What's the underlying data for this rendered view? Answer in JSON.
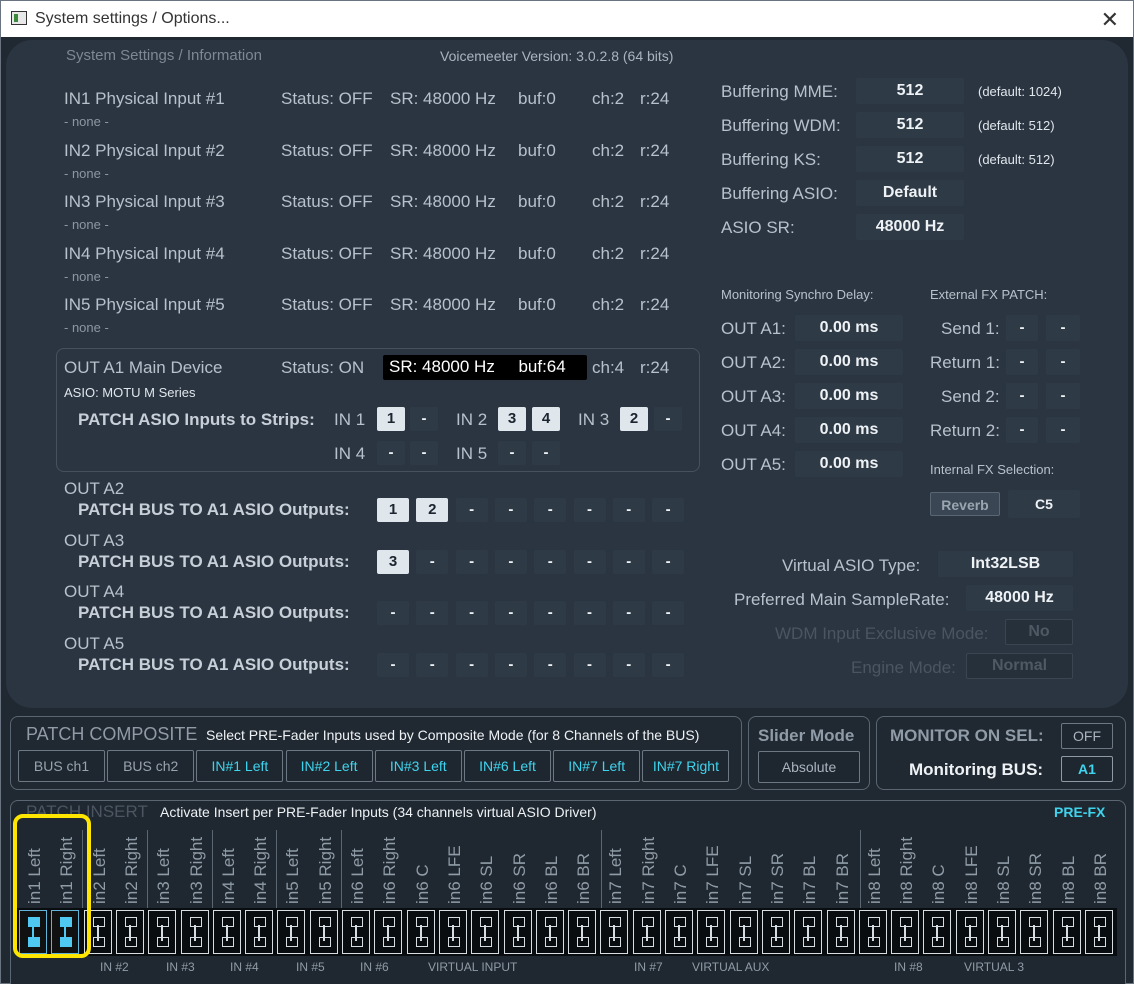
{
  "window": {
    "title": "System settings / Options..."
  },
  "header": {
    "section": "System Settings / Information",
    "version": "Voicemeeter Version: 3.0.2.8 (64 bits)"
  },
  "inputs": [
    {
      "name": "IN1 Physical Input #1",
      "device": "- none -",
      "status": "Status: OFF",
      "sr": "SR: 48000 Hz",
      "buf": "buf:0",
      "ch": "ch:2",
      "r": "r:24"
    },
    {
      "name": "IN2 Physical Input #2",
      "device": "- none -",
      "status": "Status: OFF",
      "sr": "SR: 48000 Hz",
      "buf": "buf:0",
      "ch": "ch:2",
      "r": "r:24"
    },
    {
      "name": "IN3 Physical Input #3",
      "device": "- none -",
      "status": "Status: OFF",
      "sr": "SR: 48000 Hz",
      "buf": "buf:0",
      "ch": "ch:2",
      "r": "r:24"
    },
    {
      "name": "IN4 Physical Input #4",
      "device": "- none -",
      "status": "Status: OFF",
      "sr": "SR: 48000 Hz",
      "buf": "buf:0",
      "ch": "ch:2",
      "r": "r:24"
    },
    {
      "name": "IN5 Physical Input #5",
      "device": "- none -",
      "status": "Status: OFF",
      "sr": "SR: 48000 Hz",
      "buf": "buf:0",
      "ch": "ch:2",
      "r": "r:24"
    }
  ],
  "a1": {
    "name": "OUT A1 Main Device",
    "device": "ASIO: MOTU M Series",
    "status": "Status: ON",
    "sr_buf": "SR: 48000 Hz     buf:64",
    "ch": "ch:4",
    "r": "r:24",
    "patch_label": "PATCH ASIO Inputs to Strips:",
    "in_labels": [
      "IN 1",
      "IN 2",
      "IN 3",
      "IN 4",
      "IN 5"
    ],
    "in1": [
      "1",
      "-"
    ],
    "in2": [
      "3",
      "4"
    ],
    "in3": [
      "2",
      "-"
    ],
    "in4": [
      "-",
      "-"
    ],
    "in5": [
      "-",
      "-"
    ]
  },
  "outs": [
    {
      "name": "OUT A2",
      "label": "PATCH BUS TO A1 ASIO Outputs:",
      "slots": [
        "1",
        "2",
        "-",
        "-",
        "-",
        "-",
        "-",
        "-"
      ]
    },
    {
      "name": "OUT A3",
      "label": "PATCH BUS TO A1 ASIO Outputs:",
      "slots": [
        "3",
        "-",
        "-",
        "-",
        "-",
        "-",
        "-",
        "-"
      ]
    },
    {
      "name": "OUT A4",
      "label": "PATCH BUS TO A1 ASIO Outputs:",
      "slots": [
        "-",
        "-",
        "-",
        "-",
        "-",
        "-",
        "-",
        "-"
      ]
    },
    {
      "name": "OUT A5",
      "label": "PATCH BUS TO A1 ASIO Outputs:",
      "slots": [
        "-",
        "-",
        "-",
        "-",
        "-",
        "-",
        "-",
        "-"
      ]
    }
  ],
  "buffering": [
    {
      "label": "Buffering MME:",
      "value": "512",
      "default": "(default: 1024)"
    },
    {
      "label": "Buffering WDM:",
      "value": "512",
      "default": "(default: 512)"
    },
    {
      "label": "Buffering KS:",
      "value": "512",
      "default": "(default: 512)"
    },
    {
      "label": "Buffering ASIO:",
      "value": "Default",
      "default": ""
    },
    {
      "label": "ASIO SR:",
      "value": "48000 Hz",
      "default": ""
    }
  ],
  "monitoring": {
    "title": "Monitoring Synchro Delay:",
    "rows": [
      {
        "label": "OUT A1:",
        "value": "0.00 ms"
      },
      {
        "label": "OUT A2:",
        "value": "0.00 ms"
      },
      {
        "label": "OUT A3:",
        "value": "0.00 ms"
      },
      {
        "label": "OUT A4:",
        "value": "0.00 ms"
      },
      {
        "label": "OUT A5:",
        "value": "0.00 ms"
      }
    ]
  },
  "fxpatch": {
    "title": "External FX PATCH:",
    "rows": [
      {
        "label": "Send 1:",
        "a": "-",
        "b": "-"
      },
      {
        "label": "Return 1:",
        "a": "-",
        "b": "-"
      },
      {
        "label": "Send 2:",
        "a": "-",
        "b": "-"
      },
      {
        "label": "Return 2:",
        "a": "-",
        "b": "-"
      }
    ],
    "internal_title": "Internal FX Selection:",
    "reverb": "Reverb",
    "c5": "C5"
  },
  "virtual": {
    "asio_type_label": "Virtual ASIO Type:",
    "asio_type": "Int32LSB",
    "samplerate_label": "Preferred Main SampleRate:",
    "samplerate": "48000 Hz",
    "wdm_label": "WDM Input Exclusive Mode:",
    "wdm": "No",
    "engine_label": "Engine Mode:",
    "engine": "Normal"
  },
  "composite": {
    "title": "PATCH COMPOSITE",
    "desc": "Select PRE-Fader Inputs used by Composite Mode (for 8 Channels of the BUS)",
    "buttons": [
      "BUS ch1",
      "BUS ch2",
      "IN#1 Left",
      "IN#2 Left",
      "IN#3 Left",
      "IN#6 Left",
      "IN#7 Left",
      "IN#7 Right"
    ]
  },
  "slider": {
    "title": "Slider Mode",
    "value": "Absolute"
  },
  "monitor": {
    "title": "MONITOR ON SEL:",
    "state": "OFF",
    "bus_label": "Monitoring BUS:",
    "bus": "A1"
  },
  "insert": {
    "title": "PATCH INSERT",
    "desc": "Activate Insert per PRE-Fader Inputs (34 channels virtual ASIO Driver)",
    "prefx": "PRE-FX",
    "channels": [
      "in1 Left",
      "in1 Right",
      "in2 Left",
      "in2 Right",
      "in3 Left",
      "in3 Right",
      "in4 Left",
      "in4 Right",
      "in5 Left",
      "in5 Right",
      "in6 Left",
      "in6 Right",
      "in6 C",
      "in6 LFE",
      "in6 SL",
      "in6 SR",
      "in6 BL",
      "in6 BR",
      "in7 Left",
      "in7 Right",
      "in7 C",
      "in7 LFE",
      "in7 SL",
      "in7 SR",
      "in7 BL",
      "in7 BR",
      "in8 Left",
      "in8 Right",
      "in8 C",
      "in8 LFE",
      "in8 SL",
      "in8 SR",
      "in8 BL",
      "in8 BR"
    ],
    "active": [
      true,
      true,
      false,
      false,
      false,
      false,
      false,
      false,
      false,
      false,
      false,
      false,
      false,
      false,
      false,
      false,
      false,
      false,
      false,
      false,
      false,
      false,
      false,
      false,
      false,
      false,
      false,
      false,
      false,
      false,
      false,
      false,
      false,
      false
    ],
    "groups": [
      "IN #2",
      "IN #3",
      "IN #4",
      "IN #5",
      "IN #6",
      "VIRTUAL INPUT",
      "IN #7",
      "VIRTUAL AUX",
      "IN #8",
      "VIRTUAL 3"
    ]
  },
  "colors": {
    "accent_cyan": "#3fd4ee",
    "highlight": "#ffe600",
    "active_slot": "#4fc8f2"
  }
}
